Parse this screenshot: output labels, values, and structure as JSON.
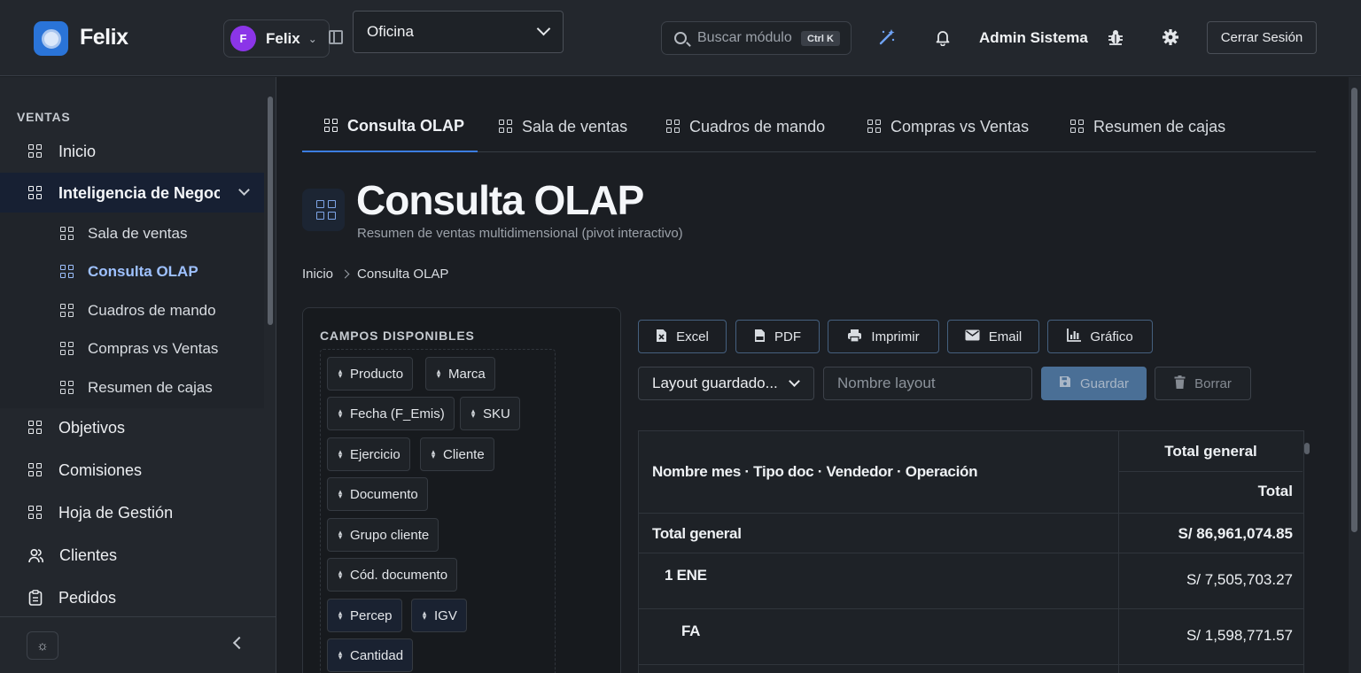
{
  "app": {
    "name": "Felix",
    "brand_color": "#2a74d8"
  },
  "header": {
    "company": {
      "initial": "F",
      "name": "Felix",
      "avatar_color": "#8b35e8"
    },
    "office_select": {
      "value": "Oficina"
    },
    "search": {
      "placeholder": "Buscar módulo",
      "shortcut": "Ctrl K"
    },
    "user_name": "Admin Sistema",
    "logout_label": "Cerrar Sesión",
    "icons": [
      "magic-wand-icon",
      "bell-icon",
      "bug-icon",
      "gear-icon"
    ]
  },
  "sidebar": {
    "section_title": "VENTAS",
    "items": [
      {
        "label": "Inicio"
      },
      {
        "label": "Inteligencia de Negocios",
        "expanded": true
      },
      {
        "label": "Objetivos"
      },
      {
        "label": "Comisiones"
      },
      {
        "label": "Hoja de Gestión"
      },
      {
        "label": "Clientes"
      },
      {
        "label": "Pedidos"
      }
    ],
    "sub_items": [
      {
        "label": "Sala de ventas"
      },
      {
        "label": "Consulta OLAP",
        "active": true
      },
      {
        "label": "Cuadros de mando"
      },
      {
        "label": "Compras vs Ventas"
      },
      {
        "label": "Resumen de cajas"
      }
    ]
  },
  "tabs": [
    {
      "label": "Consulta OLAP",
      "active": true
    },
    {
      "label": "Sala de ventas"
    },
    {
      "label": "Cuadros de mando"
    },
    {
      "label": "Compras vs Ventas"
    },
    {
      "label": "Resumen de cajas"
    }
  ],
  "page": {
    "title": "Consulta OLAP",
    "subtitle": "Resumen de ventas multidimensional (pivot interactivo)",
    "breadcrumb": [
      "Inicio",
      "Consulta OLAP"
    ]
  },
  "fields_panel": {
    "title": "CAMPOS DISPONIBLES",
    "fields": [
      "Producto",
      "Marca",
      "Fecha (F_Emis)",
      "SKU",
      "Ejercicio",
      "Cliente",
      "Documento",
      "Grupo cliente",
      "Cód. documento",
      "Percep",
      "IGV",
      "Cantidad"
    ]
  },
  "toolbar": {
    "export_buttons": [
      {
        "label": "Excel",
        "icon": "excel-file-icon"
      },
      {
        "label": "PDF",
        "icon": "pdf-file-icon"
      },
      {
        "label": "Imprimir",
        "icon": "printer-icon"
      },
      {
        "label": "Email",
        "icon": "envelope-icon"
      },
      {
        "label": "Gráfico",
        "icon": "bar-chart-icon"
      }
    ],
    "layout_select": "Layout guardado...",
    "layout_name_placeholder": "Nombre layout",
    "save_label": "Guardar",
    "delete_label": "Borrar"
  },
  "pivot": {
    "row_header": "Nombre mes · Tipo doc · Vendedor · Operación",
    "col_header_top": "Total general",
    "col_header_sub": "Total",
    "rows": [
      {
        "label": "Total general",
        "value": "S/ 86,961,074.85",
        "level": 0
      },
      {
        "label": "1 ENE",
        "value": "S/ 7,505,703.27",
        "level": 1
      },
      {
        "label": "FA",
        "value": "S/ 1,598,771.57",
        "level": 2
      }
    ]
  }
}
